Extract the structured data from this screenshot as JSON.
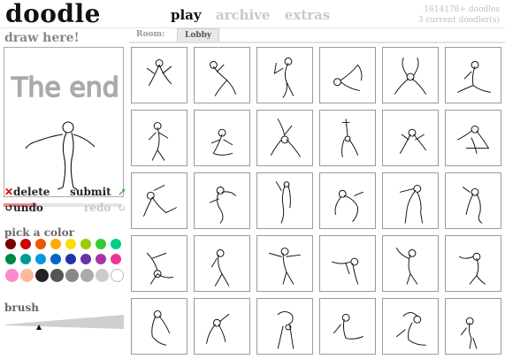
{
  "header": {
    "logo": "doodle",
    "nav": [
      {
        "label": "play",
        "active": true
      },
      {
        "label": "archive",
        "active": false
      },
      {
        "label": "extras",
        "active": false
      }
    ],
    "stats_doodles": "1614178+ doodles",
    "stats_current": "3 current doodler(s)"
  },
  "sidebar": {
    "title": "draw here!",
    "canvas_text": "The end",
    "progress": 0.28,
    "delete_label": "delete",
    "submit_label": "submit",
    "undo_label": "undo",
    "redo_label": "redo",
    "color_title": "pick a color",
    "colors_row1": [
      "#7a0000",
      "#cc0000",
      "#ee5500",
      "#ffaa00",
      "#ffdd00",
      "#99cc00",
      "#33cc33",
      "#00cc88"
    ],
    "colors_row2": [
      "#008844",
      "#009999",
      "#0099dd",
      "#0066cc",
      "#2233aa",
      "#6633aa",
      "#aa33aa",
      "#ee3399"
    ],
    "colors_row3": [
      "#ff88cc",
      "#ffbb99",
      "#222222",
      "#555555",
      "#888888",
      "#aaaaaa",
      "#cccccc",
      "#ffffff"
    ],
    "brush_title": "brush",
    "brush_level": 0.28
  },
  "tabs": [
    {
      "label": "Room:",
      "active": false
    },
    {
      "label": "Lobby",
      "active": true
    }
  ],
  "gallery": {
    "columns": 6,
    "rows": 5,
    "items": [
      "doodle-1",
      "doodle-2",
      "doodle-3",
      "doodle-4",
      "doodle-5",
      "doodle-6",
      "doodle-7",
      "doodle-8",
      "doodle-9",
      "doodle-10",
      "doodle-11",
      "doodle-12",
      "doodle-13",
      "doodle-14",
      "doodle-15",
      "doodle-16",
      "doodle-17",
      "doodle-18",
      "doodle-19",
      "doodle-20",
      "doodle-21",
      "doodle-22",
      "doodle-23",
      "doodle-24",
      "doodle-25",
      "doodle-26",
      "doodle-27",
      "doodle-28",
      "doodle-29",
      "doodle-30"
    ]
  },
  "icons": {
    "delete": "red-x-icon",
    "submit": "green-arrow-icon",
    "undo": "undo-arrow-icon",
    "redo": "redo-arrow-icon"
  },
  "colors": {
    "delete_icon": "#cc0000",
    "submit_icon": "#33aa33",
    "progress_fill": "#e88a8a"
  }
}
